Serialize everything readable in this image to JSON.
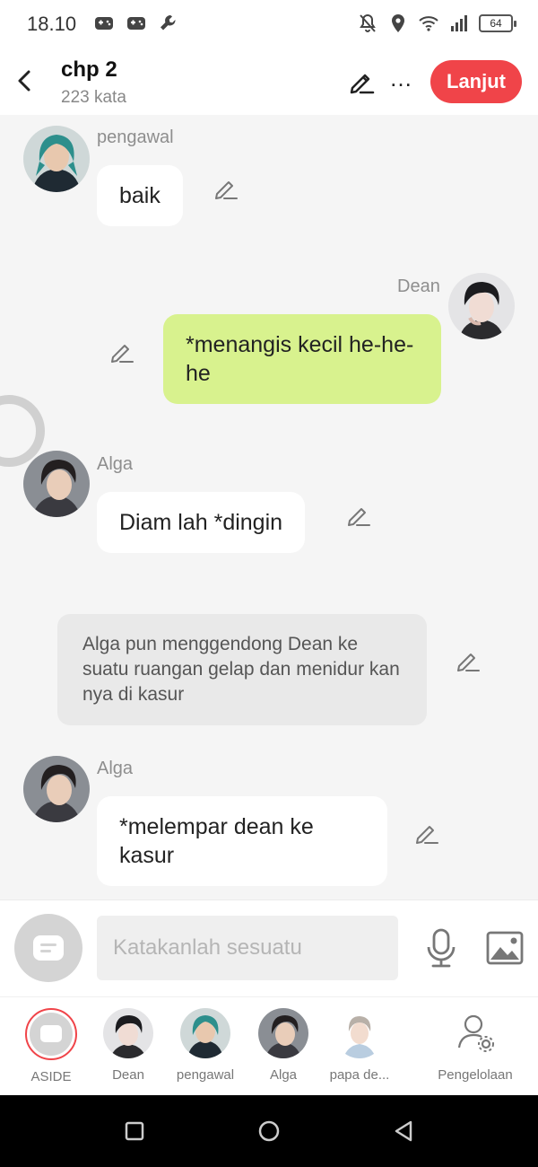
{
  "status_bar": {
    "time": "18.10",
    "battery": "64",
    "icons_left": [
      "game-controller-icon",
      "game-controller-icon",
      "wrench-icon"
    ],
    "icons_right": [
      "mute-notification-icon",
      "location-icon",
      "wifi-icon",
      "signal-icon",
      "battery-icon"
    ]
  },
  "header": {
    "title": "chp 2",
    "word_count": "223 kata",
    "next_label": "Lanjut",
    "more_label": "…",
    "accent": "#f04449"
  },
  "messages": [
    {
      "type": "incoming",
      "sender": "pengawal",
      "text": "baik"
    },
    {
      "type": "outgoing",
      "sender": "Dean",
      "text": "*menangis kecil he-he-he",
      "bubble_color": "#d8f28e"
    },
    {
      "type": "incoming",
      "sender": "Alga",
      "text": "Diam lah *dingin"
    },
    {
      "type": "narration",
      "text": "Alga pun menggendong Dean ke suatu ruangan gelap dan menidur kan nya di kasur"
    },
    {
      "type": "incoming",
      "sender": "Alga",
      "text": "*melempar dean ke kasur"
    }
  ],
  "input": {
    "placeholder": "Katakanlah sesuatu"
  },
  "characters": [
    {
      "label": "ASIDE"
    },
    {
      "label": "Dean"
    },
    {
      "label": "pengawal"
    },
    {
      "label": "Alga"
    },
    {
      "label": "papa de..."
    },
    {
      "label": "Pengelolaan"
    }
  ],
  "nav_icons": [
    "recents-square-icon",
    "home-circle-icon",
    "back-triangle-icon"
  ]
}
